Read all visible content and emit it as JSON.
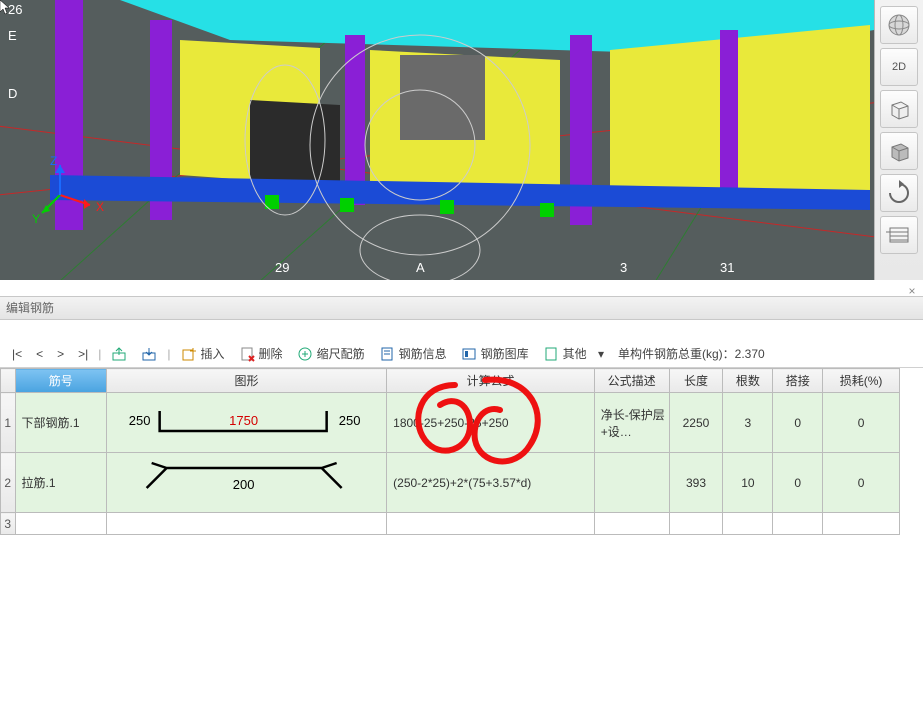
{
  "viewport": {
    "axis_labels": {
      "x": "X",
      "y": "Y",
      "z": "Z"
    },
    "grid_labels": [
      "26",
      "E",
      "D",
      "29",
      "A",
      "3",
      "31"
    ]
  },
  "right_toolbar": {
    "items": [
      "globe-icon",
      "2D",
      "cube-wire-icon",
      "cube-solid-icon",
      "rotate-icon",
      "panel-icon"
    ]
  },
  "panel": {
    "title": "编辑钢筋",
    "close": "×"
  },
  "nav": {
    "first": "|<",
    "prev": "<",
    "next": ">",
    "last": ">|"
  },
  "toolbar": {
    "insert": "插入",
    "delete": "删除",
    "scale": "缩尺配筋",
    "info": "钢筋信息",
    "library": "钢筋图库",
    "other": "其他",
    "dropdown": "▾",
    "summary_label": "单构件钢筋总重(kg)：",
    "summary_value": "2.370"
  },
  "table": {
    "headers": [
      "筋号",
      "图形",
      "计算公式",
      "公式描述",
      "长度",
      "根数",
      "搭接",
      "损耗(%)"
    ],
    "rows": [
      {
        "num": "1",
        "name": "下部钢筋.1",
        "shape": {
          "type": "u-open",
          "left": "250",
          "mid": "1750",
          "right": "250",
          "mid_color": "#d40000"
        },
        "formula": "1800-25+250-25+250",
        "desc": "净长-保护层+设…",
        "length": "2250",
        "count": "3",
        "lap": "0",
        "loss": "0"
      },
      {
        "num": "2",
        "name": "拉筋.1",
        "shape": {
          "type": "stirrup",
          "mid": "200"
        },
        "formula": "(250-2*25)+2*(75+3.57*d)",
        "desc": "",
        "length": "393",
        "count": "10",
        "lap": "0",
        "loss": "0"
      },
      {
        "num": "3",
        "name": "",
        "formula": "",
        "desc": "",
        "length": "",
        "count": "",
        "lap": "",
        "loss": ""
      }
    ]
  }
}
